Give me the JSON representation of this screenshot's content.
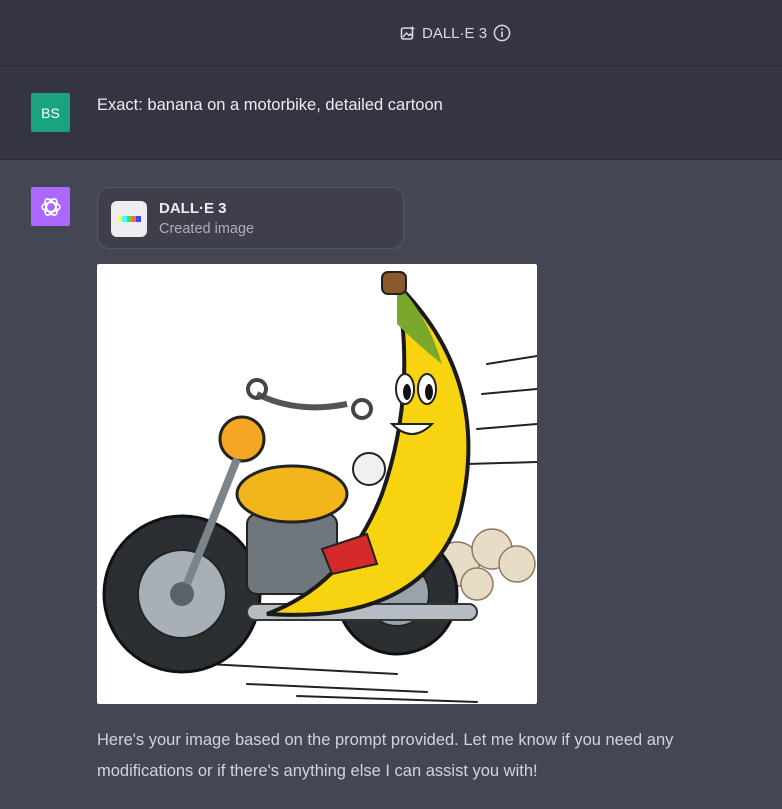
{
  "header": {
    "model_icon": "image-sparkle-icon",
    "model_name": "DALL·E 3",
    "info_icon": "info-icon"
  },
  "user_message": {
    "avatar_initials": "BS",
    "avatar_color": "#19a37f",
    "text": "Exact: banana on a motorbike, detailed cartoon"
  },
  "assistant_message": {
    "avatar_icon": "openai-logo-icon",
    "avatar_color": "#ab68ff",
    "tool_card": {
      "title": "DALL·E 3",
      "subtitle": "Created image",
      "thumb_icon": "dalle-color-bar-icon"
    },
    "image_content": "cartoon banana riding a yellow motorbike",
    "reply_text": "Here's your image based on the prompt provided. Let me know if you need any modifications or if there's anything else I can assist you with!"
  }
}
